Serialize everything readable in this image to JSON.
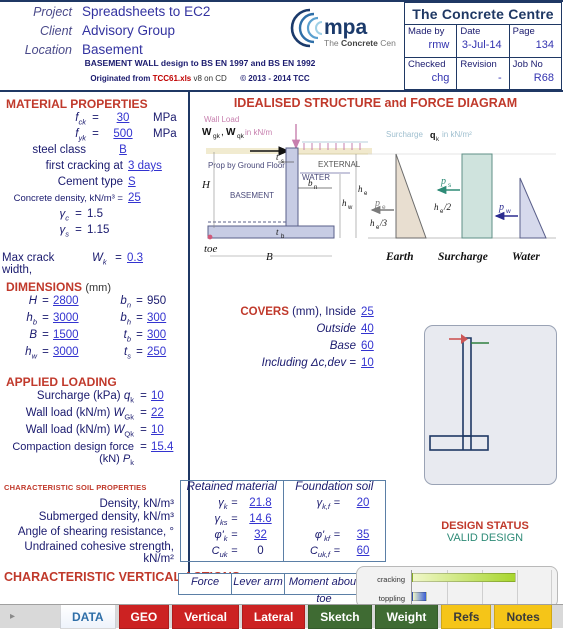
{
  "header": {
    "fields": [
      {
        "label": "Project",
        "value": "Spreadsheets to EC2"
      },
      {
        "label": "Client",
        "value": "Advisory Group"
      },
      {
        "label": "Location",
        "value": "Basement"
      }
    ],
    "subtitle": "BASEMENT WALL design to BS EN 1997 and BS EN 1992",
    "origin_prefix": "Originated from",
    "origin_file": "TCC61.xls",
    "origin_ver": "v8 on CD",
    "copyright": "© 2013 - 2014 TCC",
    "logo_text": "mpa",
    "logo_sub_thin1": "The ",
    "logo_sub_bold": "Concrete",
    "logo_sub_thin2": " Centre",
    "tcc_title": "The Concrete Centre",
    "made_by_label": "Made by",
    "made_by_value": "rmw",
    "date_label": "Date",
    "date_value": "3-Jul-14",
    "page_label": "Page",
    "page_value": "134",
    "checked_label": "Checked",
    "checked_value": "chg",
    "revision_label": "Revision",
    "revision_value": "-",
    "jobno_label": "Job No",
    "jobno_value": "R68"
  },
  "material": {
    "heading": "MATERIAL PROPERTIES",
    "fck_label": "f",
    "fck_sub": "ck",
    "fck_value": "30",
    "fck_unit": "MPa",
    "fyk_label": "f",
    "fyk_sub": "yk",
    "fyk_value": "500",
    "fyk_unit": "MPa",
    "steel_class_label": "steel class",
    "steel_class_value": "B",
    "first_cracking_label": "first cracking at",
    "first_cracking_value": "3 days",
    "cement_type_label": "Cement type",
    "cement_type_value": "S",
    "density_label": "Concrete density, kN/m³ =",
    "density_value": "25",
    "gamma_c_label": "γ",
    "gamma_c_sub": "c",
    "gamma_c_value": "1.5",
    "gamma_s_label": "γ",
    "gamma_s_sub": "s",
    "gamma_s_value": "1.15",
    "crack_label": "Max crack width,",
    "crack_sym": "W",
    "crack_sub": "k",
    "crack_value": "0.3"
  },
  "dimensions": {
    "heading": "DIMENSIONS",
    "heading_unit": "(mm)",
    "left": [
      {
        "sym": "H",
        "sub": "",
        "value": "2800",
        "underlined": true
      },
      {
        "sym": "h",
        "sub": "b",
        "value": "3000",
        "underlined": true
      },
      {
        "sym": "B",
        "sub": "",
        "value": "1500",
        "underlined": true
      },
      {
        "sym": "h",
        "sub": "w",
        "value": "3000",
        "underlined": true
      }
    ],
    "right": [
      {
        "sym": "b",
        "sub": "n",
        "value": "950",
        "underlined": false
      },
      {
        "sym": "b",
        "sub": "h",
        "value": "300",
        "underlined": true
      },
      {
        "sym": "t",
        "sub": "b",
        "value": "300",
        "underlined": true
      },
      {
        "sym": "t",
        "sub": "s",
        "value": "250",
        "underlined": true
      }
    ]
  },
  "covers": {
    "heading": "COVERS",
    "rows": [
      {
        "label": "(mm), Inside",
        "value": "25"
      },
      {
        "label": "Outside",
        "value": "40"
      },
      {
        "label": "Base",
        "value": "60"
      },
      {
        "label": "Including Δc,dev =",
        "value": "10"
      }
    ]
  },
  "loading": {
    "heading": "APPLIED LOADING",
    "rows": [
      {
        "label": "Surcharge (kPa)",
        "sym": "q",
        "sub": "k",
        "value": "10"
      },
      {
        "label": "Wall load (kN/m)",
        "sym": "W",
        "sub": "Gk",
        "value": "22"
      },
      {
        "label": "Wall load (kN/m)",
        "sym": "W",
        "sub": "Qk",
        "value": "10"
      },
      {
        "label": "Compaction design force (kN)",
        "sym": "P",
        "sub": "k",
        "value": "15.4"
      }
    ]
  },
  "soil": {
    "heading": "CHARACTERISTIC SOIL PROPERTIES",
    "col1": "Retained material",
    "col2": "Foundation soil",
    "rows": [
      {
        "label": "Density, kN/m³",
        "s1": "γ",
        "s1sub": "k",
        "v1": "21.8",
        "u1": true,
        "s2": "γ",
        "s2sub": "k,f",
        "v2": "20",
        "u2": true
      },
      {
        "label": "Submerged density, kN/m³",
        "s1": "γ",
        "s1sub": "ks",
        "v1": "14.6",
        "u1": true,
        "s2": "",
        "s2sub": "",
        "v2": "",
        "u2": false
      },
      {
        "label": "Angle of shearing resistance, °",
        "s1": "φ'",
        "s1sub": "k",
        "v1": "32",
        "u1": true,
        "s2": "φ'",
        "s2sub": "kf",
        "v2": "35",
        "u2": true
      },
      {
        "label": "Undrained cohesive strength, kN/m²",
        "s1": "C",
        "s1sub": "uk",
        "v1": "0",
        "u1": false,
        "s2": "C",
        "s2sub": "uk,f",
        "v2": "60",
        "u2": true
      }
    ]
  },
  "design_status": {
    "title": "DESIGN STATUS",
    "value": "VALID DESIGN",
    "color": "#2e8b77"
  },
  "diagram": {
    "title": "IDEALISED STRUCTURE and FORCE DIAGRAM",
    "wall_load_label": "Wall Load",
    "wall_load_sym": "W",
    "wall_load_sub1": "gk",
    "wall_load_sym2": "W",
    "wall_load_sub2": "qk",
    "wall_load_unit": "in kN/m",
    "surcharge_label": "Surcharge",
    "surcharge_sym": "q",
    "surcharge_sub": "k",
    "surcharge_unit": "in kN/m²",
    "prop_label": "Prop by Ground Floor",
    "external_label": "EXTERNAL",
    "water_label": "WATER",
    "basement_label": "BASEMENT",
    "toe_label": "toe",
    "dim_H": "H",
    "dim_B": "B",
    "dim_ts": "t",
    "dim_ts_sub": "s",
    "dim_tb": "t",
    "dim_tb_sub": "b",
    "dim_bn": "b",
    "dim_bn_sub": "n",
    "dim_he": "h",
    "dim_he_sub": "e",
    "dim_hw": "h",
    "dim_hw_sub": "w",
    "pe_sym": "p",
    "pe_sub": "e",
    "ps_sym": "p",
    "ps_sub": "s",
    "pw_sym": "p",
    "pw_sub": "w",
    "he_over_3": "h",
    "he_over_3_sub": "e",
    "he_over_3_tail": "/3",
    "he_over_2_tail": "/2",
    "earth_label": "Earth",
    "surcharge_cap": "Surcharge",
    "water_cap": "Water",
    "colors": {
      "earth": "#e8ded0",
      "surcharge": "#cfe3dd",
      "water": "#d6d9ec",
      "wall": "#c7cce4"
    }
  },
  "vertical_actions": {
    "heading": "CHARACTERISTIC VERTICAL ACTIONS",
    "columns": [
      "Force",
      "Lever arm",
      "Moment about toe"
    ]
  },
  "chart_data": {
    "type": "bar",
    "orientation": "horizontal",
    "title": "",
    "categories": [
      "cracking",
      "toppling"
    ],
    "values": [
      74,
      11
    ],
    "xlim": [
      0,
      100
    ],
    "ylabel": "",
    "xlabel": "",
    "grid": true,
    "series": [
      {
        "name": "utilisation",
        "values": [
          74,
          11
        ],
        "colors": [
          "#a8d62e",
          "#3b5fd6"
        ]
      }
    ]
  },
  "tabs": [
    {
      "label": "DATA",
      "style": "active"
    },
    {
      "label": "GEO",
      "style": "geo"
    },
    {
      "label": "Vertical",
      "style": "geo"
    },
    {
      "label": "Lateral",
      "style": "geo"
    },
    {
      "label": "Sketch",
      "style": "green"
    },
    {
      "label": "Weight",
      "style": "green"
    },
    {
      "label": "Refs",
      "style": "yellow"
    },
    {
      "label": "Notes",
      "style": "yellow"
    }
  ],
  "nav_arrow": "▸"
}
